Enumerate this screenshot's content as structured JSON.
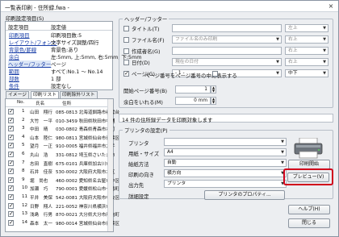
{
  "window": {
    "title": "一覧表印刷 - 住所録.fwa -",
    "close": "×"
  },
  "left_panel": {
    "group_title": "印刷設定項目(S)",
    "col_item": "設定項目",
    "col_value": "設定値",
    "settings": [
      {
        "label": "印刷項目",
        "value": "印刷項目数:5"
      },
      {
        "label": "レイアウト/フォント",
        "value": "文字サイズ調整/四行"
      },
      {
        "label": "背景色/罫線",
        "value": "背景色:あり"
      },
      {
        "label": "余白",
        "value": "左:5mm, 上:5mm, 右:5mm, 下:5mm"
      },
      {
        "label": "ヘッダー/フッター",
        "value": "ページ"
      },
      {
        "label": "範囲",
        "value": "すべて:No.1 ～ No.14"
      },
      {
        "label": "部数",
        "value": "1 部"
      },
      {
        "label": "条件",
        "value": "設定なし"
      }
    ],
    "tabs": [
      "イメージ",
      "印刷リスト",
      "印刷除外リスト"
    ],
    "list_headers": {
      "no": "No.",
      "name": "氏名",
      "addr": "住所"
    },
    "list_rows": [
      {
        "no": "1",
        "name": "山田　翔行",
        "addr": "085-0813 北海道釧路市春雲台"
      },
      {
        "no": "2",
        "name": "大竹　一平",
        "addr": "010-3459 秋田県秋田市中通"
      },
      {
        "no": "3",
        "name": "中田　晴",
        "addr": "030-0802 青森県青森市本町"
      },
      {
        "no": "4",
        "name": "山本　陸仁",
        "addr": "980-0811 宮城県仙台市青葉区"
      },
      {
        "no": "5",
        "name": "望月　一正",
        "addr": "910-0005 福井県福井市大手"
      },
      {
        "no": "6",
        "name": "丸山　浩",
        "addr": "331-0812 埼玉県さいたま市"
      },
      {
        "no": "7",
        "name": "志田　直樹",
        "addr": "675-0101 兵庫県加古川市"
      },
      {
        "no": "8",
        "name": "石井　佳奈",
        "addr": "530-0002 大阪府大阪市北区"
      },
      {
        "no": "9",
        "name": "堀　尚也",
        "addr": "460-0002 愛知県名古屋市中区"
      },
      {
        "no": "10",
        "name": "加瀬　巧",
        "addr": "790-0001 愛媛県松山市一番町"
      },
      {
        "no": "11",
        "name": "平井　美保",
        "addr": "542-0081 大阪府大阪市中央区"
      },
      {
        "no": "12",
        "name": "日野　翔人",
        "addr": "221-0052 神奈川県横浜市"
      },
      {
        "no": "13",
        "name": "浅島　行男",
        "addr": "870-0021 大分県大分市府内町"
      },
      {
        "no": "14",
        "name": "森本　太一",
        "addr": "980-0014 宮城県仙台市青葉区"
      }
    ]
  },
  "header_footer": {
    "group_title": "ヘッダー/フッター",
    "items": [
      {
        "label": "タイトル(T)",
        "checked": false,
        "value": "",
        "align": "左上"
      },
      {
        "label": "ファイル名(F)",
        "checked": false,
        "value": "ファイル名のみ印刷",
        "align": "右上"
      },
      {
        "label": "作成者名(G)",
        "checked": false,
        "value": "",
        "align": "右上"
      },
      {
        "label": "日付(D)",
        "checked": false,
        "value": "現在の日付",
        "align": "右上"
      },
      {
        "label": "ページ(G)",
        "checked": true,
        "value": "- 1 -",
        "align": "中下"
      }
    ],
    "each_page_note": "ページ番号をページ番号の中に表示する",
    "start_page_label": "開始ページ番号(B)",
    "start_page_value": "1",
    "margin_label": "余白をいれる(M)",
    "margin_value": "0 mm"
  },
  "status": "14 件の住所録データを印刷対象します",
  "printer": {
    "group_title": "プリンタの設定(P)",
    "printer_label": "プリンタ",
    "printer_value": "",
    "paper_label": "用紙・サイズ",
    "paper_value": "A4",
    "source_label": "給紙方法",
    "source_value": "自動",
    "orient_label": "印刷の向き",
    "orient_value": "横方向",
    "output_label": "出力先",
    "output_value": "プリンタ",
    "detail_label": "詳細設定",
    "properties_button": "プリンタのプロパティ..."
  },
  "buttons": {
    "print": "印刷開始",
    "preview": "プレビュー(V)",
    "help": "ヘルプ(H)",
    "close": "閉じる"
  },
  "accent": "#d0021b"
}
